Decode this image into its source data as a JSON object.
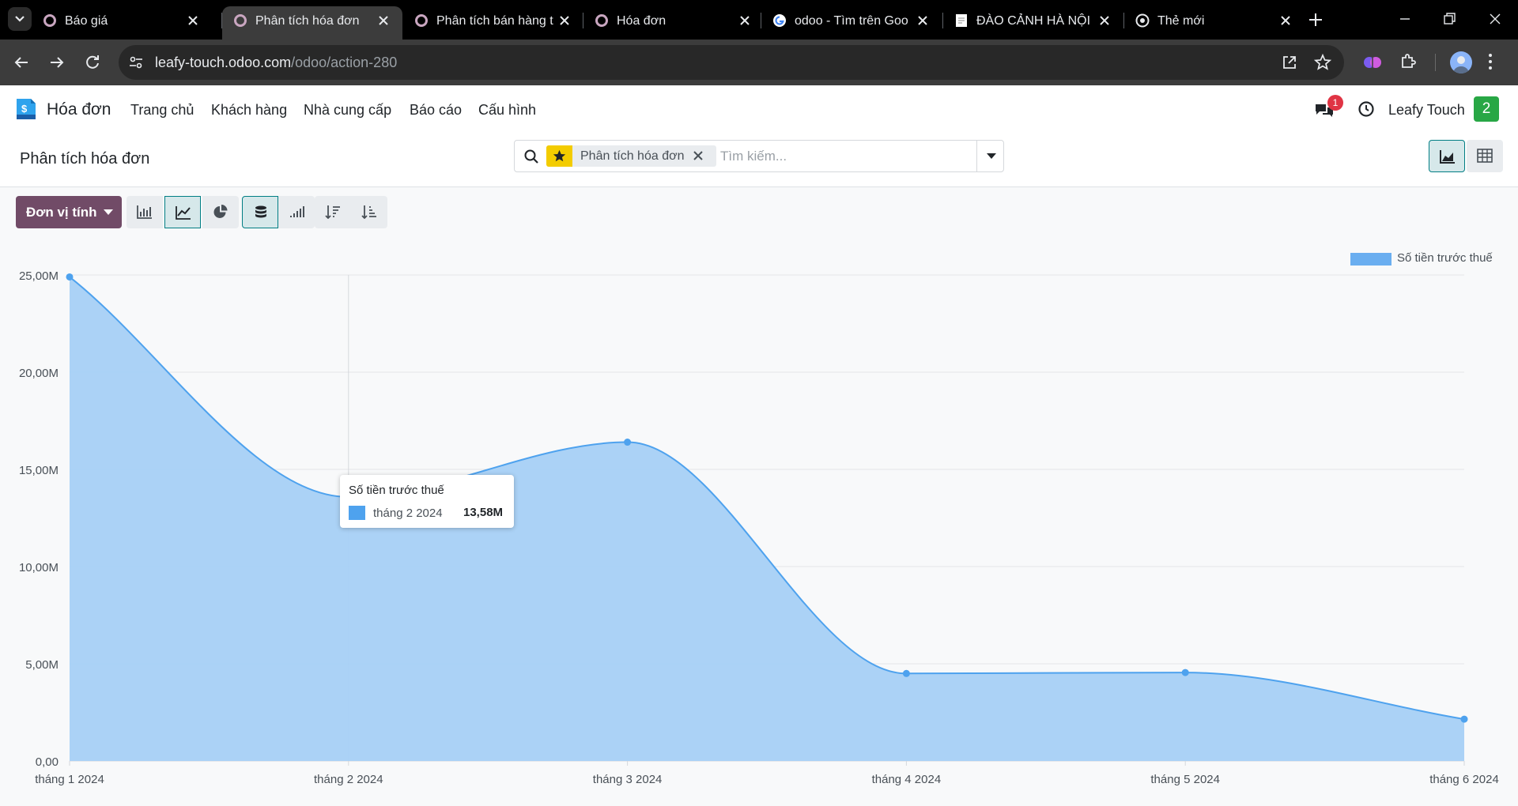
{
  "browser": {
    "tabs": [
      {
        "title": "Báo giá",
        "favicon": "odoo-icon",
        "active": false
      },
      {
        "title": "Phân tích hóa đơn",
        "favicon": "odoo-icon",
        "active": true
      },
      {
        "title": "Phân tích bán hàng t",
        "favicon": "odoo-icon",
        "active": false
      },
      {
        "title": "Hóa đơn",
        "favicon": "odoo-icon",
        "active": false
      },
      {
        "title": "odoo - Tìm trên Goo",
        "favicon": "google-icon",
        "active": false
      },
      {
        "title": "ĐÀO CẢNH HÀ NỘI",
        "favicon": "page-icon",
        "active": false
      },
      {
        "title": "Thẻ mới",
        "favicon": "chrome-icon",
        "active": false
      }
    ],
    "url_host": "leafy-touch.odoo.com",
    "url_path": "/odoo/action-280"
  },
  "navbar": {
    "app_name": "Hóa đơn",
    "menu": [
      "Trang chủ",
      "Khách hàng",
      "Nhà cung cấp",
      "Báo cáo",
      "Cấu hình"
    ],
    "chat_badge": "1",
    "company": "Leafy Touch",
    "user_badge": "2"
  },
  "control_panel": {
    "breadcrumb": "Phân tích hóa đơn",
    "facet_label": "Phân tích hóa đơn",
    "search_placeholder": "Tìm kiếm..."
  },
  "toolbar": {
    "measure_label": "Đơn vị tính"
  },
  "tooltip": {
    "title": "Số tiền trước thuế",
    "label": "tháng 2 2024",
    "value": "13,58M"
  },
  "colors": {
    "accent": "#714b67",
    "series_line": "#4ea2ee",
    "series_fill": "#a6d0f5",
    "active_teal": "#017e84"
  },
  "chart_data": {
    "type": "area",
    "title": "",
    "xlabel": "",
    "ylabel": "",
    "categories": [
      "tháng 1 2024",
      "tháng 2 2024",
      "tháng 3 2024",
      "tháng 4 2024",
      "tháng 5 2024",
      "tháng 6 2024"
    ],
    "series": [
      {
        "name": "Số tiền trước thuế",
        "values": [
          24.9,
          13.58,
          16.4,
          4.5,
          4.55,
          2.15
        ]
      }
    ],
    "ylim": [
      0,
      25
    ],
    "yticks": [
      0,
      5,
      10,
      15,
      20,
      25
    ],
    "ytick_labels": [
      "0,00",
      "5,00M",
      "10,00M",
      "15,00M",
      "20,00M",
      "25,00M"
    ],
    "grid": true,
    "legend": "top-right",
    "stacked": true,
    "cumulative": false
  }
}
